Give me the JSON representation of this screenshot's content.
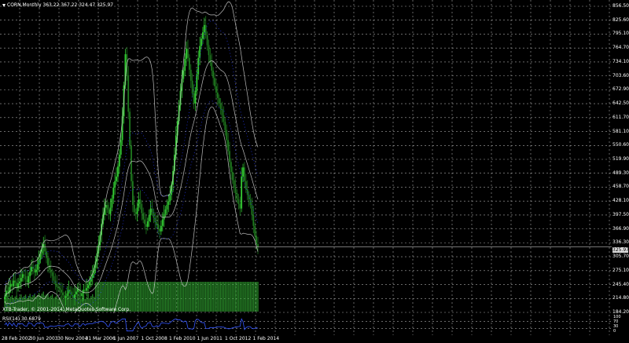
{
  "window": {
    "title_prefix": "▼",
    "title": "CORN,Monthly  363.22 367.22 324.47 325.97"
  },
  "price_axis": {
    "labels": [
      "856.50",
      "825.60",
      "795.10",
      "764.70",
      "734.10",
      "703.60",
      "672.90",
      "642.50",
      "611.70",
      "581.10",
      "550.60",
      "519.90",
      "489.30",
      "458.70",
      "428.10",
      "397.50",
      "366.90",
      "336.30",
      "305.70",
      "275.10",
      "245.40",
      "214.80",
      "184.20"
    ],
    "current_price": "325.97"
  },
  "rsi": {
    "label": "RSI(14) 30.6879",
    "axis_labels": [
      "100",
      "70",
      "30",
      "0"
    ]
  },
  "time_axis": {
    "labels": [
      "28 Feb 2002",
      "30 Jun 2003",
      "30 Nov 2004",
      "31 Mar 2006",
      "1 Jun 2007",
      "1 Oct 2008",
      "1 Feb 2010",
      "1 Jun 2011",
      "1 Oct 2012",
      "1 Feb 2014"
    ]
  },
  "footer": {
    "copyright": "XTB-Trader, © 2001-2014, MetaQuotes Software Corp."
  },
  "colors": {
    "background": "#000000",
    "grid": "#a8a8a8",
    "bull_candle": "#33cc33",
    "bear_candle": "#1f7a1f",
    "volume": "#2fa02f",
    "bollinger": "#dcdcdc",
    "envelope": "#2233dd",
    "rsi_line": "#3355ff",
    "text": "#ffffff"
  },
  "chart_data": {
    "type": "candlestick",
    "instrument": "CORN",
    "timeframe": "Monthly",
    "ohlc_last": {
      "open": 363.22,
      "high": 367.22,
      "low": 324.47,
      "close": 325.97
    },
    "ylim": [
      184.2,
      856.5
    ],
    "x_start": "2001-05",
    "x_end": "2014-09",
    "closes": [
      217,
      230,
      224,
      238,
      245,
      240,
      252,
      248,
      236,
      246,
      250,
      258,
      266,
      262,
      255,
      248,
      262,
      272,
      282,
      278,
      270,
      276,
      288,
      298,
      312,
      324,
      332,
      316,
      302,
      286,
      276,
      270,
      262,
      252,
      244,
      238,
      236,
      232,
      226,
      220,
      214,
      218,
      224,
      232,
      228,
      220,
      214,
      222,
      228,
      234,
      226,
      218,
      224,
      232,
      230,
      236,
      242,
      250,
      258,
      266,
      280,
      294,
      312,
      330,
      352,
      376,
      396,
      412,
      418,
      408,
      398,
      412,
      432,
      456,
      470,
      480,
      502,
      528,
      560,
      612,
      680,
      748,
      702,
      622,
      548,
      470,
      418,
      402,
      398,
      412,
      430,
      420,
      400,
      386,
      376,
      370,
      382,
      396,
      410,
      402,
      390,
      380,
      376,
      366,
      360,
      372,
      386,
      398,
      408,
      418,
      426,
      440,
      462,
      492,
      528,
      570,
      602,
      636,
      668,
      694,
      712,
      738,
      760,
      740,
      714,
      690,
      662,
      640,
      668,
      704,
      740,
      766,
      782,
      796,
      812,
      790,
      768,
      746,
      730,
      712,
      696,
      678,
      664,
      652,
      640,
      628,
      614,
      600,
      582,
      560,
      536,
      512,
      490,
      472,
      456,
      444,
      430,
      420,
      410,
      480,
      500,
      470,
      452,
      440,
      430,
      418,
      396,
      372,
      350,
      332,
      326
    ],
    "indicators": [
      "Bollinger Bands",
      "Envelopes",
      "Volume",
      "RSI(14)"
    ],
    "rsi_last": 30.6879,
    "rsi_levels": [
      70,
      30
    ]
  }
}
